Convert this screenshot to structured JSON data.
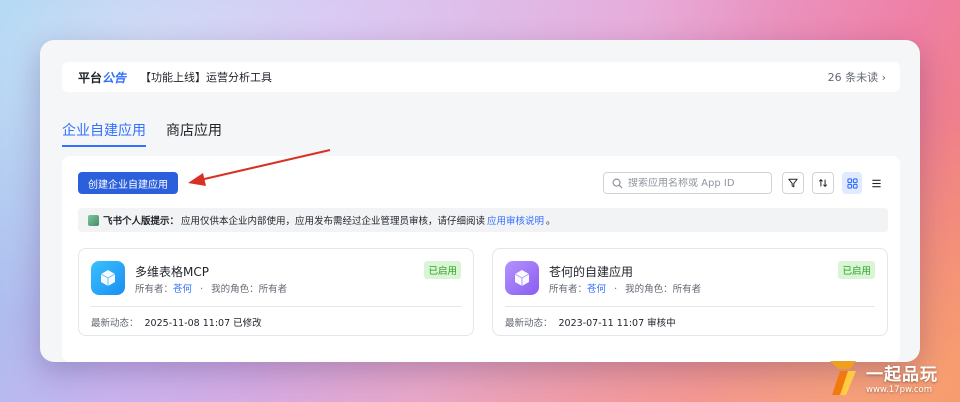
{
  "notice": {
    "brand_main": "平台",
    "brand_accent": "公告",
    "text": "【功能上线】运营分析工具",
    "unread": "26 条未读",
    "unread_chevron": "›"
  },
  "tabs": [
    {
      "label": "企业自建应用",
      "active": true
    },
    {
      "label": "商店应用",
      "active": false
    }
  ],
  "toolbar": {
    "create_label": "创建企业自建应用",
    "search_placeholder": "搜索应用名称或 App ID",
    "filter_icon": "filter-icon",
    "sort_icon": "sort-icon",
    "grid_view_icon": "grid-view-icon",
    "list_view_icon": "list-view-icon"
  },
  "tip": {
    "title": "飞书个人版提示：",
    "text": "应用仅供本企业内部使用，应用发布需经过企业管理员审核，请仔细阅读",
    "link": "应用审核说明",
    "end": "。"
  },
  "apps": [
    {
      "name": "多维表格MCP",
      "status": "已启用",
      "owner_label": "所有者：",
      "owner": "苍何",
      "sep": "·",
      "role_label": "我的角色：",
      "role": "所有者",
      "activity_label": "最新动态：",
      "activity": "2025-11-08 11:07 已修改",
      "icon_color": "#1aa3f4"
    },
    {
      "name": "苍何的自建应用",
      "status": "已启用",
      "owner_label": "所有者：",
      "owner": "苍何",
      "sep": "·",
      "role_label": "我的角色：",
      "role": "所有者",
      "activity_label": "最新动态：",
      "activity": "2023-07-11 11:07 审核中",
      "icon_color": "#9b6ff2"
    }
  ],
  "watermark": {
    "title": "一起品玩",
    "url": "www.17pw.com"
  },
  "colors": {
    "accent": "#3370ff",
    "button": "#2b5fdc",
    "enabled_bg": "#d9f5d6",
    "enabled_text": "#2ea121",
    "arrow": "#d93025"
  }
}
